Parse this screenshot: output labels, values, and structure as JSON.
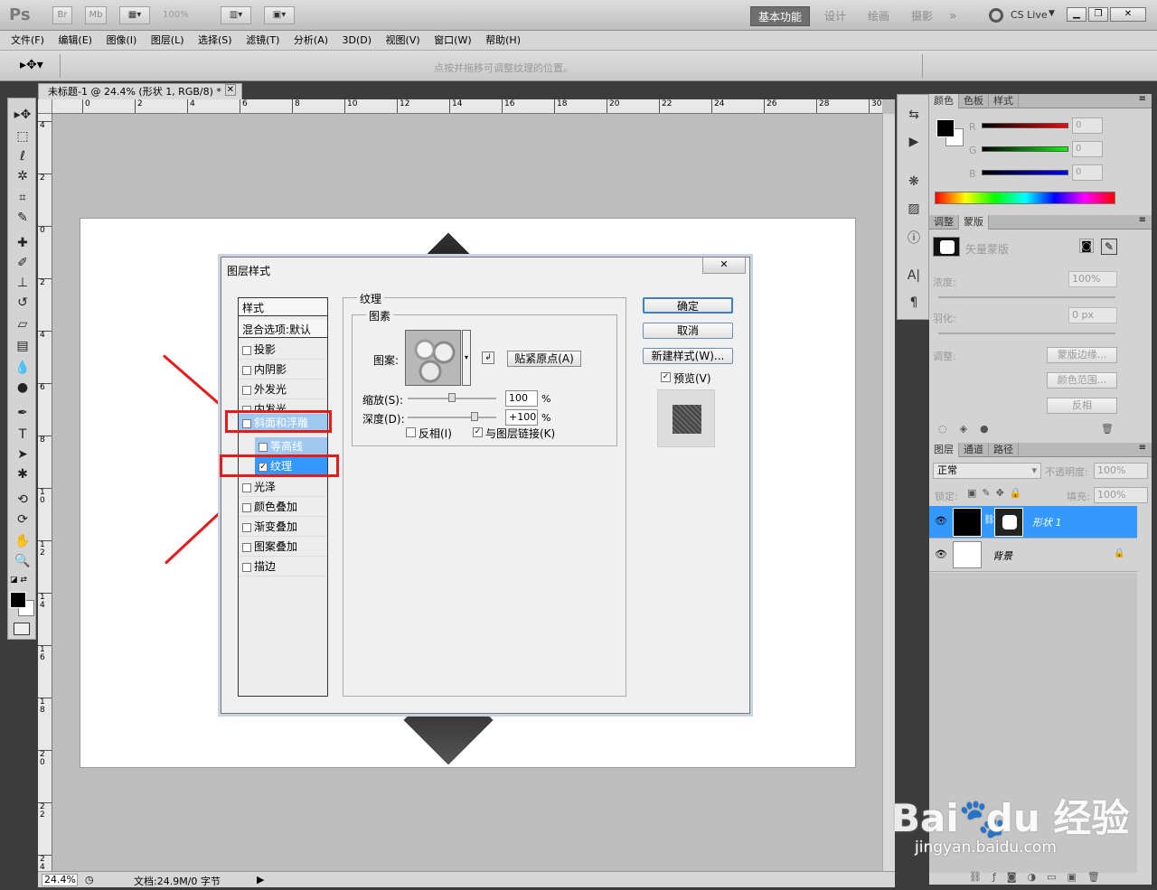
{
  "app": {
    "logo": "Ps",
    "btn_br": "Br",
    "btn_mb": "Mb",
    "zoom_btn": "100%",
    "cs_live": "CS Live"
  },
  "workspaces": [
    "基本功能",
    "设计",
    "绘画",
    "摄影",
    "»"
  ],
  "menu": [
    "文件(F)",
    "编辑(E)",
    "图像(I)",
    "图层(L)",
    "选择(S)",
    "滤镜(T)",
    "分析(A)",
    "3D(D)",
    "视图(V)",
    "窗口(W)",
    "帮助(H)"
  ],
  "options_hint": "点按并拖移可调整纹理的位置。",
  "doc_tab": "未标题-1 @ 24.4% (形状 1, RGB/8) *",
  "ruler_top": [
    "0",
    "2",
    "4",
    "6",
    "8",
    "10",
    "12",
    "14",
    "16",
    "18",
    "20",
    "22",
    "24",
    "26",
    "28",
    "30"
  ],
  "ruler_left": [
    "4",
    "2",
    "0",
    "2",
    "4",
    "6",
    "8",
    "1\n0",
    "1\n2",
    "1\n4",
    "1\n6",
    "1\n8",
    "2\n0",
    "2\n2",
    "2\n4"
  ],
  "status": {
    "zoom": "24.4%",
    "doc": "文档:24.9M/0 字节"
  },
  "color_panel": {
    "tabs": [
      "颜色",
      "色板",
      "样式"
    ],
    "r": "0",
    "g": "0",
    "b": "0",
    "labels": [
      "R",
      "G",
      "B"
    ]
  },
  "adjust_panel": {
    "tabs": [
      "调整",
      "蒙版"
    ],
    "vector_mask": "矢量蒙版",
    "density_label": "浓度:",
    "density": "100%",
    "feather_label": "羽化:",
    "feather": "0 px",
    "refine_label": "调整:",
    "mask_edge": "蒙版边缘...",
    "color_range": "颜色范围...",
    "invert": "反相"
  },
  "layers_panel": {
    "tabs": [
      "图层",
      "通道",
      "路径"
    ],
    "blend": "正常",
    "opacity_label": "不透明度:",
    "opacity": "100%",
    "lock_label": "锁定:",
    "fill_label": "填充:",
    "fill": "100%",
    "layers": [
      "形状 1",
      "背景"
    ]
  },
  "dialog": {
    "title": "图层样式",
    "styles_header": "样式",
    "blend_options": "混合选项:默认",
    "items": [
      "投影",
      "内阴影",
      "外发光",
      "内发光",
      "斜面和浮雕",
      "等高线",
      "纹理",
      "光泽",
      "颜色叠加",
      "渐变叠加",
      "图案叠加",
      "描边"
    ],
    "checked": [
      "斜面和浮雕",
      "纹理"
    ],
    "section": "纹理",
    "subsection": "图素",
    "pattern_label": "图案:",
    "snap_origin": "贴紧原点(A)",
    "scale_label": "缩放(S):",
    "scale": "100",
    "depth_label": "深度(D):",
    "depth": "+100",
    "percent": "%",
    "invert": "反相(I)",
    "link_layer": "与图层链接(K)",
    "ok": "确定",
    "cancel": "取消",
    "new_style": "新建样式(W)...",
    "preview": "预览(V)"
  },
  "watermark": {
    "brand": "Bai",
    "brand2": "du",
    "cn": "经验",
    "url": "jingyan.baidu.com"
  }
}
